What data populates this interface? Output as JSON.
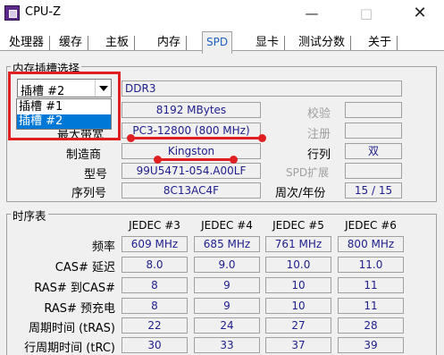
{
  "window": {
    "title": "CPU-Z",
    "minimize_glyph": "—",
    "maximize_glyph": "□",
    "close_glyph": "✕"
  },
  "tabs": [
    "处理器",
    "缓存",
    "主板",
    "内存",
    "SPD",
    "显卡",
    "测试分数",
    "关于"
  ],
  "active_tab": "SPD",
  "slot_group": {
    "title": "内存插槽选择",
    "selected_slot": "插槽 #2",
    "dropdown_options": [
      "插槽 #1",
      "插槽 #2"
    ],
    "memory_type": "DDR3",
    "max_bandwidth_label": "最大带宽",
    "module_size": "8192 MBytes",
    "max_bandwidth": "PC3-12800 (800 MHz)",
    "manufacturer_label": "制造商",
    "manufacturer": "Kingston",
    "part_number_label": "型号",
    "part_number": "99U5471-054.A00LF",
    "serial_number_label": "序列号",
    "serial_number": "8C13AC4F",
    "correction_label": "校验",
    "registered_label": "注册",
    "ranks_label": "行列",
    "ranks": "双",
    "spd_ext_label": "SPD扩展",
    "week_year_label": "周次/年份",
    "week_year": "15 / 15"
  },
  "timings": {
    "title": "时序表",
    "columns": [
      "JEDEC #3",
      "JEDEC #4",
      "JEDEC #5",
      "JEDEC #6"
    ],
    "rows": [
      {
        "label": "频率",
        "values": [
          "609 MHz",
          "685 MHz",
          "761 MHz",
          "800 MHz"
        ]
      },
      {
        "label": "CAS# 延迟",
        "values": [
          "8.0",
          "9.0",
          "10.0",
          "11.0"
        ]
      },
      {
        "label": "RAS# 到CAS#",
        "values": [
          "8",
          "9",
          "10",
          "11"
        ]
      },
      {
        "label": "RAS# 预充电",
        "values": [
          "8",
          "9",
          "10",
          "11"
        ]
      },
      {
        "label": "周期时间 (tRAS)",
        "values": [
          "22",
          "24",
          "27",
          "28"
        ]
      },
      {
        "label": "行周期时间 (tRC)",
        "values": [
          "30",
          "33",
          "37",
          "39"
        ]
      }
    ]
  },
  "annotation_color": "#e02020",
  "accent_color": "#1f5fbf",
  "value_color": "#1e1e8c"
}
